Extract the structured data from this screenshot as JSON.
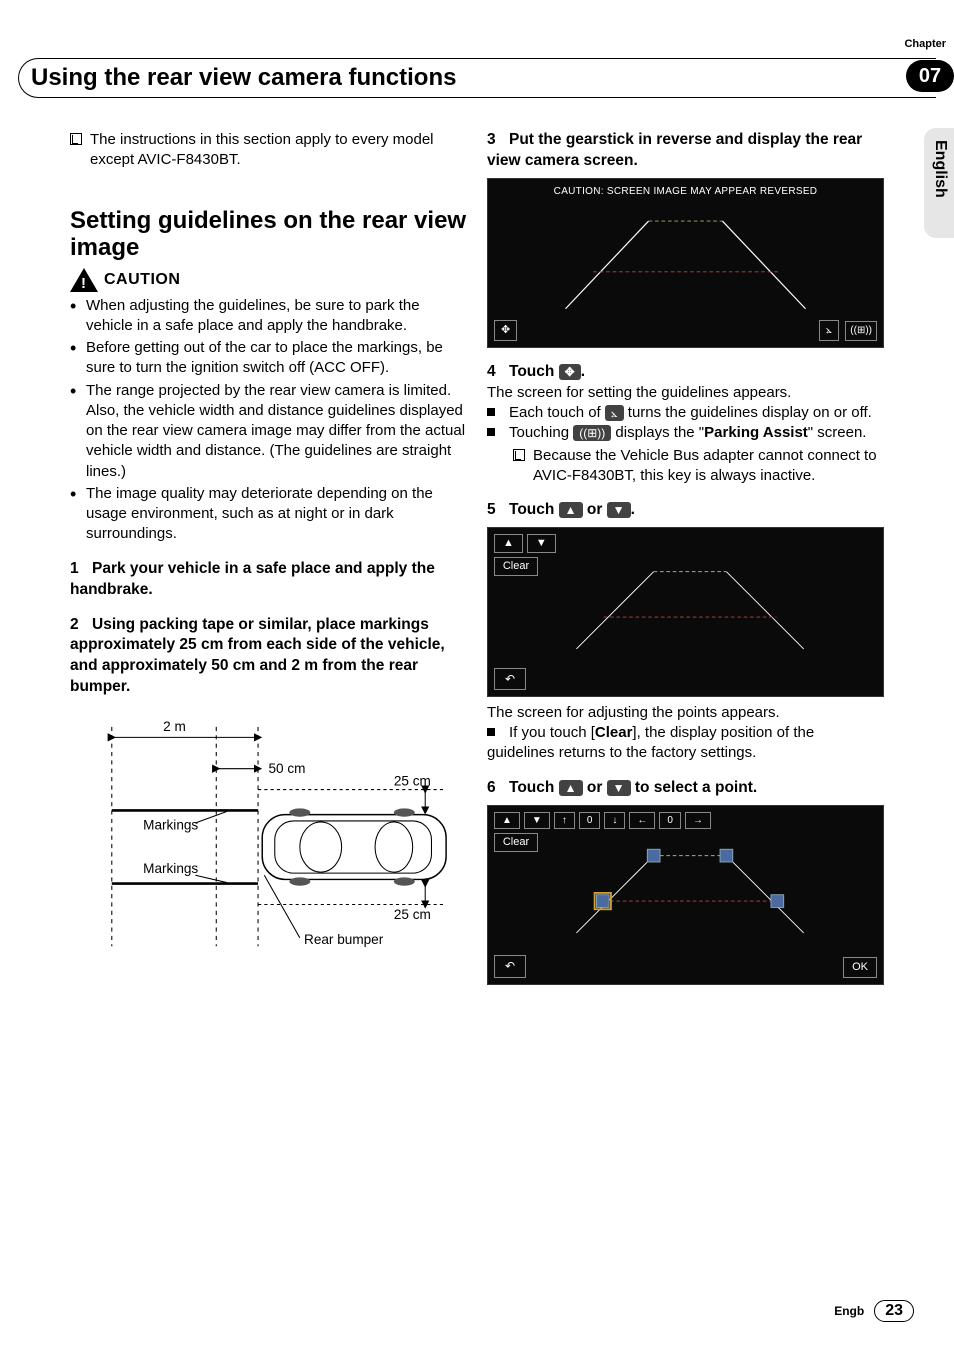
{
  "header": {
    "chapter_label": "Chapter",
    "chapter_number": "07",
    "title": "Using the rear view camera functions"
  },
  "side_tab": "English",
  "left": {
    "note": "The instructions in this section apply to every model except AVIC-F8430BT.",
    "section_title": "Setting guidelines on the rear view image",
    "caution_label": "CAUTION",
    "caution_items": [
      "When adjusting the guidelines, be sure to park the vehicle in a safe place and apply the handbrake.",
      "Before getting out of the car to place the markings, be sure to turn the ignition switch off (ACC OFF).",
      "The range projected by the rear view camera is limited. Also, the vehicle width and distance guidelines displayed on the rear view camera image may differ from the actual vehicle width and distance. (The guidelines are straight lines.)",
      "The image quality may deteriorate depending on the usage environment, such as at night or in dark surroundings."
    ],
    "step1": {
      "num": "1",
      "text": "Park your vehicle in a safe place and apply the handbrake."
    },
    "step2": {
      "num": "2",
      "text": "Using packing tape or similar, place markings approximately 25 cm from each side of the vehicle, and approximately 50 cm and 2 m from the rear bumper."
    },
    "diagram": {
      "d_2m": "2 m",
      "d_50cm": "50 cm",
      "d_25cm_top": "25 cm",
      "d_25cm_bot": "25 cm",
      "markings_top": "Markings",
      "markings_bot": "Markings",
      "rear_bumper": "Rear bumper"
    }
  },
  "right": {
    "step3": {
      "num": "3",
      "text": "Put the gearstick in reverse and display the rear view camera screen."
    },
    "screen1_caption": "CAUTION: SCREEN IMAGE MAY APPEAR REVERSED",
    "step4": {
      "num": "4",
      "prefix": "Touch ",
      "after_icon": ".",
      "line1": "The screen for setting the guidelines appears.",
      "bullet1a": "Each touch of ",
      "bullet1b": " turns the guidelines display on or off.",
      "bullet2a": "Touching ",
      "bullet2b": " displays the \"",
      "bullet2c": "Parking Assist",
      "bullet2d": "\" screen.",
      "subnote": "Because the Vehicle Bus adapter cannot connect to AVIC-F8430BT, this key is always inactive."
    },
    "step5": {
      "num": "5",
      "prefix": "Touch ",
      "mid": " or ",
      "suffix": ".",
      "clear_label": "Clear",
      "line1": "The screen for adjusting the points appears.",
      "bullet1a": "If you touch [",
      "bullet1b": "Clear",
      "bullet1c": "], the display position of the guidelines returns to the factory settings."
    },
    "step6": {
      "num": "6",
      "prefix": "Touch ",
      "mid": " or ",
      "suffix": " to select a point.",
      "clear_label": "Clear",
      "zero": "0",
      "ok": "OK"
    }
  },
  "footer": {
    "lang": "Engb",
    "page": "23"
  }
}
